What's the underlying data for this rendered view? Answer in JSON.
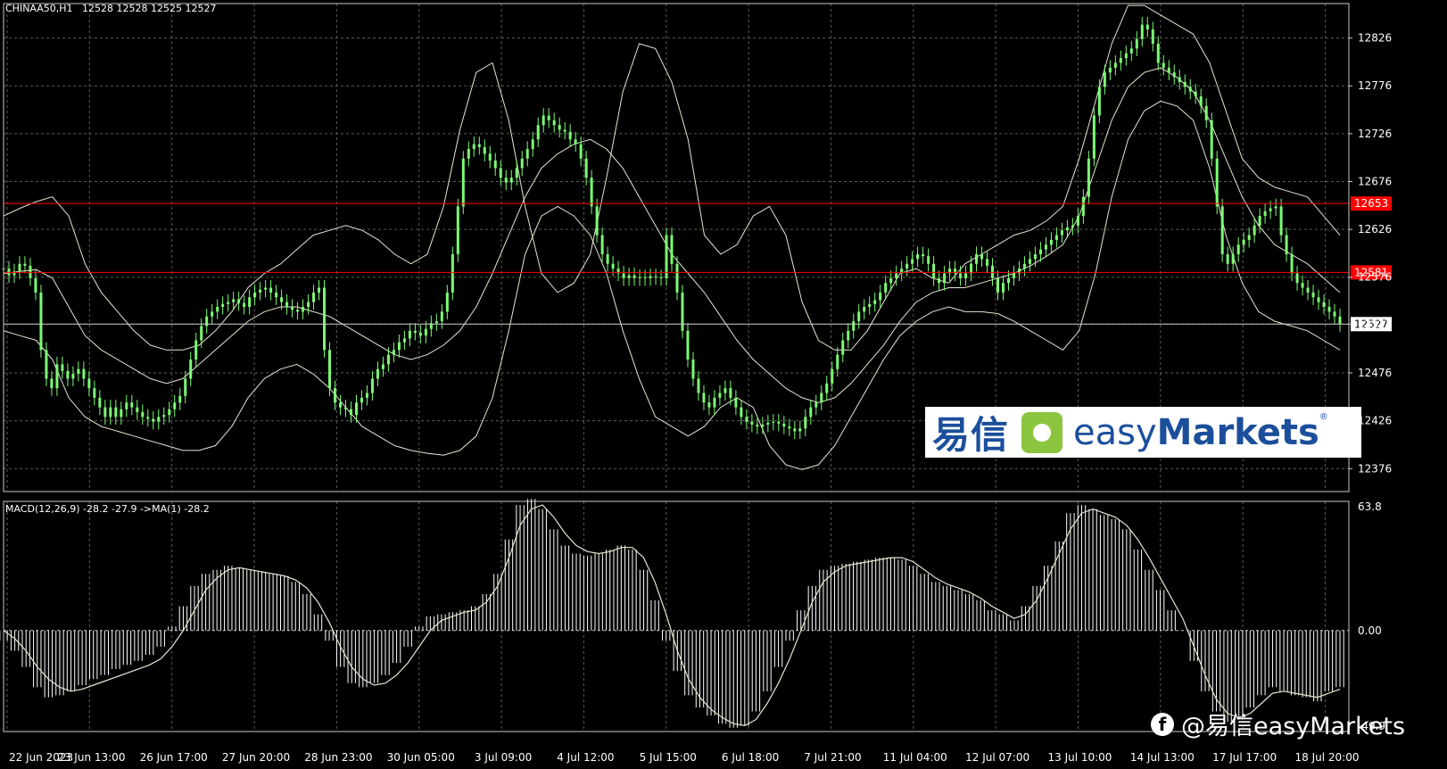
{
  "header": {
    "symbol": "CHINAA50,H1",
    "ohlc": "12528 12528 12525 12527"
  },
  "macd_header": "MACD(12,26,9) -28.2 -27.9  ->MA(1) -28.2",
  "watermark": {
    "icon": "facebook-icon",
    "text": "@易信easyMarkets"
  },
  "logo": {
    "cn": "易信",
    "en_light": "easy",
    "en_bold": "Markets",
    "reg": "®"
  },
  "colors": {
    "background": "#000000",
    "grid": "#5a5a5a",
    "candle": "#7CFC74",
    "band": "#e6e6d2",
    "level_line": "#ff0000",
    "text": "#ffffff",
    "histogram": "#ffffff"
  },
  "chart_data": [
    {
      "type": "candlestick",
      "title": "CHINAA50,H1",
      "y_ticks": [
        12826,
        12776,
        12726,
        12676,
        12626,
        12576,
        12527,
        12476,
        12426,
        12376
      ],
      "ylim": [
        12352,
        12862
      ],
      "x_ticks": [
        "22 Jun 2023",
        "23 Jun 13:00",
        "26 Jun 17:00",
        "27 Jun 20:00",
        "28 Jun 23:00",
        "30 Jun 05:00",
        "3 Jul 09:00",
        "4 Jul 12:00",
        "5 Jul 15:00",
        "6 Jul 18:00",
        "7 Jul 21:00",
        "11 Jul 04:00",
        "12 Jul 07:00",
        "13 Jul 10:00",
        "14 Jul 13:00",
        "17 Jul 17:00",
        "18 Jul 20:00"
      ],
      "close_series": [
        12585,
        12578,
        12582,
        12590,
        12588,
        12575,
        12560,
        12500,
        12470,
        12460,
        12485,
        12478,
        12470,
        12475,
        12480,
        12470,
        12460,
        12450,
        12440,
        12430,
        12440,
        12430,
        12438,
        12445,
        12440,
        12435,
        12430,
        12428,
        12425,
        12430,
        12432,
        12438,
        12445,
        12452,
        12470,
        12490,
        12510,
        12525,
        12535,
        12540,
        12545,
        12548,
        12550,
        12553,
        12549,
        12545,
        12555,
        12560,
        12563,
        12565,
        12560,
        12555,
        12550,
        12545,
        12542,
        12540,
        12545,
        12550,
        12560,
        12565,
        12500,
        12460,
        12445,
        12440,
        12438,
        12432,
        12445,
        12450,
        12455,
        12470,
        12480,
        12485,
        12495,
        12500,
        12508,
        12512,
        12520,
        12518,
        12515,
        12522,
        12528,
        12530,
        12540,
        12560,
        12600,
        12650,
        12700,
        12710,
        12715,
        12712,
        12705,
        12698,
        12690,
        12680,
        12675,
        12680,
        12690,
        12700,
        12710,
        12720,
        12735,
        12745,
        12740,
        12735,
        12730,
        12728,
        12720,
        12715,
        12700,
        12680,
        12650,
        12620,
        12600,
        12590,
        12585,
        12580,
        12575,
        12578,
        12575,
        12576,
        12575,
        12577,
        12576,
        12575,
        12620,
        12590,
        12560,
        12520,
        12490,
        12470,
        12455,
        12445,
        12440,
        12450,
        12455,
        12460,
        12450,
        12440,
        12430,
        12425,
        12422,
        12420,
        12422,
        12424,
        12425,
        12423,
        12420,
        12418,
        12415,
        12418,
        12430,
        12440,
        12445,
        12455,
        12465,
        12480,
        12495,
        12510,
        12520,
        12530,
        12540,
        12545,
        12548,
        12552,
        12560,
        12570,
        12575,
        12580,
        12585,
        12590,
        12595,
        12600,
        12598,
        12590,
        12575,
        12570,
        12580,
        12585,
        12580,
        12575,
        12580,
        12590,
        12600,
        12595,
        12588,
        12575,
        12560,
        12570,
        12575,
        12580,
        12585,
        12590,
        12595,
        12600,
        12605,
        12610,
        12615,
        12620,
        12625,
        12628,
        12630,
        12640,
        12660,
        12700,
        12745,
        12775,
        12790,
        12795,
        12800,
        12805,
        12810,
        12815,
        12825,
        12840,
        12835,
        12820,
        12800,
        12795,
        12790,
        12785,
        12780,
        12775,
        12770,
        12765,
        12755,
        12740,
        12700,
        12650,
        12600,
        12590,
        12600,
        12610,
        12615,
        12620,
        12630,
        12640,
        12645,
        12648,
        12650,
        12620,
        12600,
        12580,
        12570,
        12565,
        12560,
        12555,
        12550,
        12545,
        12540,
        12535,
        12527
      ],
      "upper_band_series": [
        12640,
        12648,
        12655,
        12660,
        12640,
        12590,
        12560,
        12540,
        12520,
        12505,
        12500,
        12500,
        12505,
        12520,
        12540,
        12565,
        12580,
        12590,
        12605,
        12620,
        12625,
        12630,
        12625,
        12615,
        12600,
        12590,
        12600,
        12650,
        12730,
        12790,
        12800,
        12740,
        12650,
        12580,
        12560,
        12570,
        12600,
        12680,
        12770,
        12820,
        12815,
        12780,
        12720,
        12620,
        12600,
        12610,
        12640,
        12650,
        12620,
        12550,
        12510,
        12500,
        12500,
        12520,
        12550,
        12580,
        12585,
        12575,
        12570,
        12590,
        12600,
        12610,
        12620,
        12625,
        12635,
        12650,
        12700,
        12760,
        12820,
        12860,
        12860,
        12850,
        12840,
        12830,
        12800,
        12750,
        12700,
        12680,
        12670,
        12665,
        12660,
        12640,
        12620
      ],
      "middle_band_series": [
        12580,
        12582,
        12584,
        12575,
        12545,
        12515,
        12500,
        12490,
        12480,
        12470,
        12465,
        12470,
        12485,
        12500,
        12515,
        12530,
        12540,
        12545,
        12545,
        12540,
        12535,
        12525,
        12515,
        12505,
        12495,
        12490,
        12495,
        12505,
        12520,
        12545,
        12580,
        12620,
        12660,
        12690,
        12705,
        12715,
        12720,
        12710,
        12690,
        12660,
        12630,
        12600,
        12580,
        12560,
        12535,
        12510,
        12490,
        12475,
        12460,
        12450,
        12445,
        12450,
        12465,
        12485,
        12505,
        12530,
        12550,
        12560,
        12565,
        12565,
        12570,
        12575,
        12580,
        12588,
        12598,
        12610,
        12640,
        12690,
        12740,
        12775,
        12790,
        12795,
        12785,
        12770,
        12740,
        12700,
        12660,
        12630,
        12610,
        12600,
        12590,
        12575,
        12560
      ],
      "lower_band_series": [
        12520,
        12515,
        12510,
        12490,
        12450,
        12430,
        12420,
        12415,
        12410,
        12405,
        12400,
        12395,
        12395,
        12400,
        12420,
        12450,
        12470,
        12480,
        12485,
        12475,
        12460,
        12440,
        12420,
        12410,
        12400,
        12395,
        12392,
        12390,
        12395,
        12410,
        12450,
        12520,
        12600,
        12640,
        12650,
        12640,
        12620,
        12580,
        12520,
        12470,
        12430,
        12420,
        12410,
        12420,
        12440,
        12450,
        12440,
        12400,
        12380,
        12375,
        12380,
        12400,
        12430,
        12460,
        12490,
        12515,
        12530,
        12540,
        12545,
        12540,
        12540,
        12538,
        12530,
        12520,
        12510,
        12500,
        12520,
        12580,
        12660,
        12720,
        12750,
        12760,
        12755,
        12740,
        12690,
        12620,
        12570,
        12540,
        12530,
        12525,
        12520,
        12510,
        12500
      ],
      "horizontal_levels": [
        {
          "value": 12653,
          "label": "12653",
          "color": "#ff0000"
        },
        {
          "value": 12581,
          "label": "12581",
          "color": "#ff0000"
        }
      ],
      "current_price": {
        "value": 12527,
        "label": "12527"
      }
    },
    {
      "type": "histogram",
      "title": "MACD(12,26,9) -28.2 -27.9  ->MA(1) -28.2",
      "ylim": [
        -49.9,
        63.8
      ],
      "y_ticks": [
        63.8,
        0.0,
        -49.9
      ],
      "y_tick_labels": [
        "63.8",
        "0.00",
        "-49.9"
      ],
      "macd_series": [
        -5,
        -10,
        -18,
        -28,
        -33,
        -32,
        -30,
        -27,
        -24,
        -22,
        -19,
        -17,
        -15,
        -12,
        -8,
        2,
        12,
        22,
        28,
        30,
        32,
        31,
        30,
        29,
        28,
        27,
        24,
        18,
        8,
        -5,
        -18,
        -26,
        -28,
        -26,
        -22,
        -16,
        -8,
        2,
        7,
        8,
        9,
        10,
        12,
        18,
        28,
        45,
        62,
        65,
        60,
        50,
        42,
        38,
        37,
        38,
        40,
        42,
        40,
        30,
        15,
        -5,
        -20,
        -32,
        -38,
        -42,
        -46,
        -48,
        -47,
        -40,
        -30,
        -18,
        -5,
        10,
        22,
        30,
        32,
        33,
        34,
        35,
        36,
        36,
        35,
        32,
        28,
        24,
        22,
        20,
        18,
        15,
        10,
        8,
        5,
        12,
        22,
        32,
        44,
        58,
        62,
        60,
        57,
        55,
        50,
        40,
        30,
        20,
        10,
        0,
        -15,
        -30,
        -40,
        -45,
        -44,
        -38,
        -32,
        -28,
        -30,
        -32,
        -33,
        -35,
        -30,
        -28
      ],
      "signal_series": [
        0,
        -4,
        -10,
        -18,
        -24,
        -28,
        -30,
        -29,
        -27,
        -25,
        -23,
        -21,
        -19,
        -17,
        -14,
        -8,
        0,
        10,
        20,
        26,
        30,
        31,
        30,
        29,
        28,
        27,
        25,
        21,
        14,
        4,
        -8,
        -18,
        -24,
        -27,
        -26,
        -22,
        -16,
        -8,
        0,
        5,
        7,
        9,
        10,
        14,
        22,
        36,
        52,
        60,
        62,
        56,
        48,
        42,
        39,
        38,
        39,
        41,
        41,
        36,
        24,
        8,
        -10,
        -24,
        -33,
        -39,
        -43,
        -46,
        -47,
        -44,
        -36,
        -26,
        -14,
        0,
        14,
        24,
        29,
        32,
        33,
        34,
        35,
        36,
        36,
        34,
        30,
        26,
        23,
        21,
        19,
        16,
        12,
        9,
        6,
        8,
        15,
        26,
        38,
        50,
        58,
        60,
        58,
        56,
        52,
        45,
        36,
        26,
        16,
        6,
        -8,
        -22,
        -34,
        -41,
        -43,
        -41,
        -36,
        -31,
        -30,
        -31,
        -32,
        -33,
        -31,
        -29
      ]
    }
  ]
}
